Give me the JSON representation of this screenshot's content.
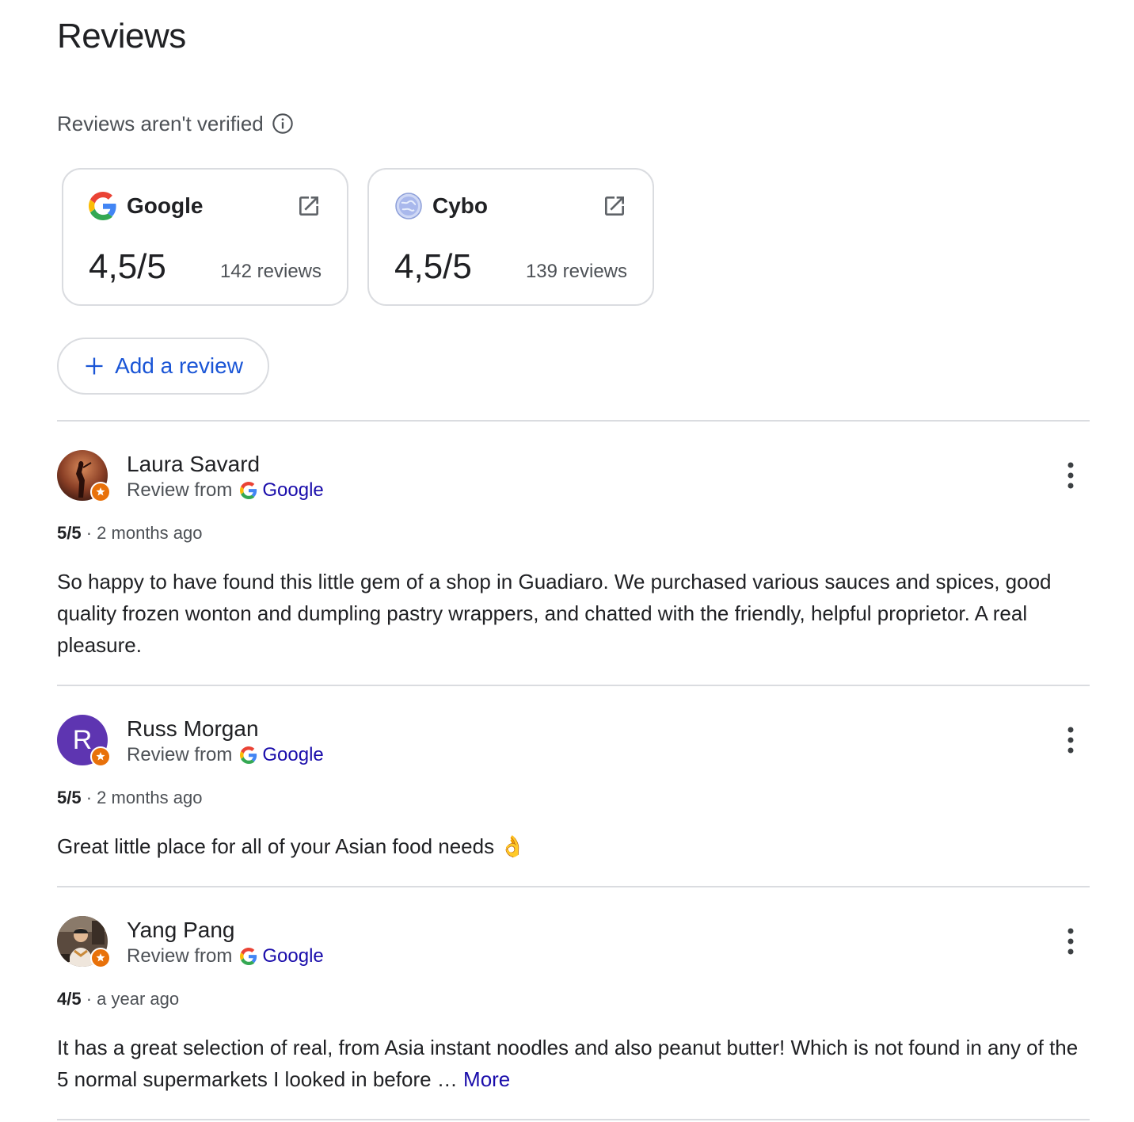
{
  "header": {
    "title": "Reviews",
    "verified_note": "Reviews aren't verified"
  },
  "sources": [
    {
      "name": "Google",
      "rating": "4,5/5",
      "count": "142 reviews",
      "icon": "google-g-icon"
    },
    {
      "name": "Cybo",
      "rating": "4,5/5",
      "count": "139 reviews",
      "icon": "cybo-globe-icon"
    }
  ],
  "add_review": {
    "label": "Add a review",
    "accent": "#1a55d6"
  },
  "reviews": [
    {
      "name": "Laura Savard",
      "from_label": "Review from",
      "source": "Google",
      "score": "5/5",
      "separator": "·",
      "time": "2 months ago",
      "text": "So happy to have found this little gem of a shop in Guadiaro. We purchased various sauces and spices, good quality frozen wonton and dumpling pastry wrappers, and chatted with the friendly, helpful proprietor. A real pleasure."
    },
    {
      "name": "Russ Morgan",
      "initial": "R",
      "from_label": "Review from",
      "source": "Google",
      "score": "5/5",
      "separator": "·",
      "time": "2 months ago",
      "text": "Great little place for all of your Asian food needs 👌"
    },
    {
      "name": "Yang Pang",
      "from_label": "Review from",
      "source": "Google",
      "score": "4/5",
      "separator": "·",
      "time": "a year ago",
      "text": "It has a great selection of real, from Asia instant noodles and also peanut butter! Which is not found in any of the 5 normal supermarkets I looked in before …",
      "more_label": "More"
    }
  ],
  "colors": {
    "link": "#1a0dab",
    "badge": "#e8710a",
    "avatar_purple": "#5e35b1",
    "divider": "#dadce0"
  }
}
